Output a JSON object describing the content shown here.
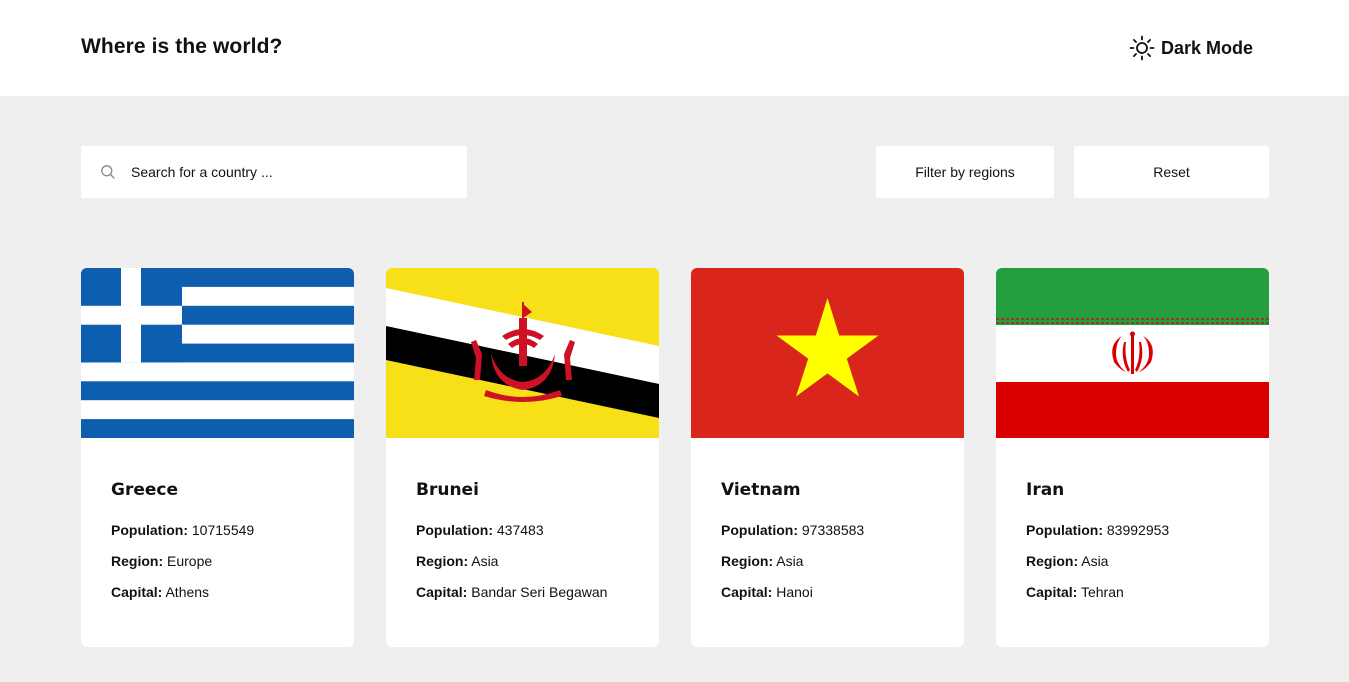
{
  "header": {
    "title": "Where is the world?",
    "dark_mode_label": "Dark Mode",
    "dark_mode_icon": "sun-icon"
  },
  "search": {
    "placeholder": "Search for a country ...",
    "value": "",
    "icon": "search-icon"
  },
  "filter": {
    "label": "Filter by regions"
  },
  "reset": {
    "label": "Reset"
  },
  "labels": {
    "population": "Population:",
    "region": "Region:",
    "capital": "Capital:"
  },
  "countries": [
    {
      "name": "Greece",
      "population": "10715549",
      "region": "Europe",
      "capital": "Athens",
      "flag": "greece-flag"
    },
    {
      "name": "Brunei",
      "population": "437483",
      "region": "Asia",
      "capital": "Bandar Seri Begawan",
      "flag": "brunei-flag"
    },
    {
      "name": "Vietnam",
      "population": "97338583",
      "region": "Asia",
      "capital": "Hanoi",
      "flag": "vietnam-flag"
    },
    {
      "name": "Iran",
      "population": "83992953",
      "region": "Asia",
      "capital": "Tehran",
      "flag": "iran-flag"
    }
  ],
  "colors": {
    "page_background": "#efefef",
    "surface": "#ffffff",
    "text": "#111111"
  }
}
